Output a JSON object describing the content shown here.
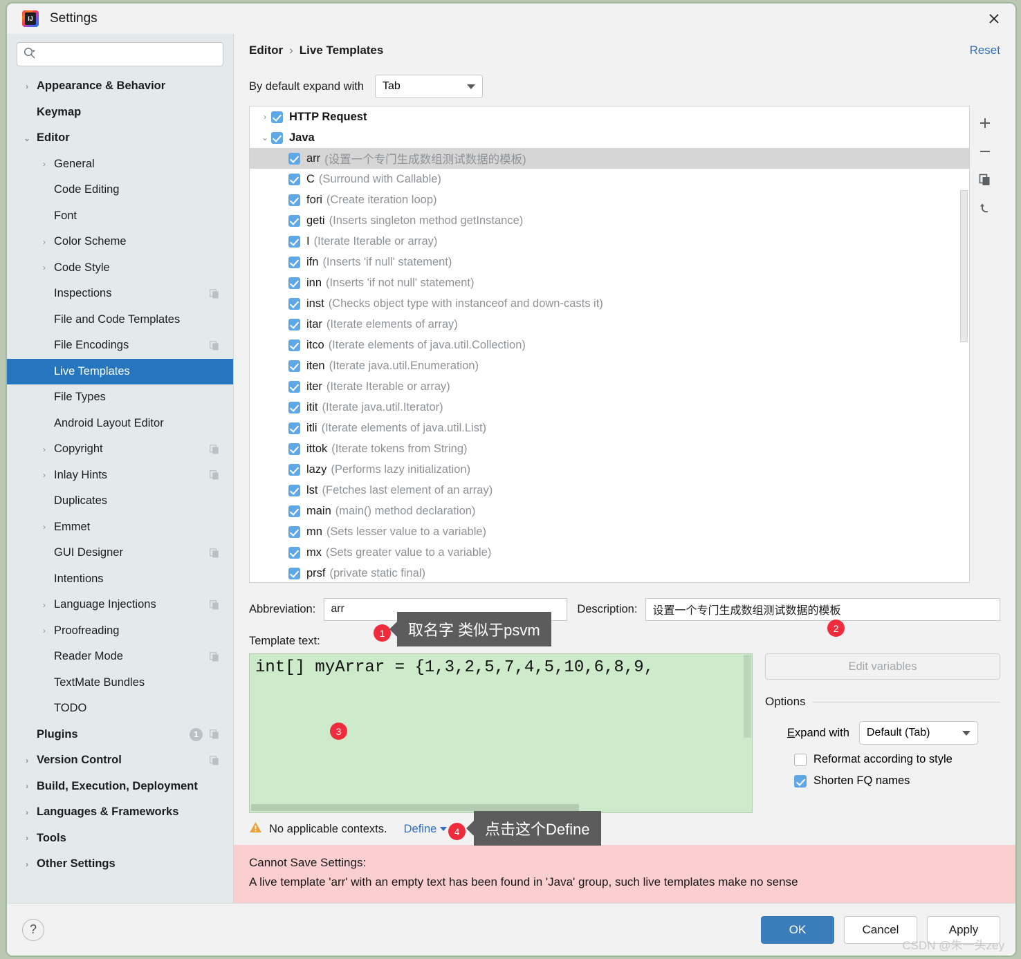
{
  "window": {
    "title": "Settings",
    "close_icon": "close-icon",
    "app_icon": "intellij-idea-icon"
  },
  "sidebar": {
    "search": {
      "placeholder": "",
      "value": "",
      "icon": "search-icon"
    },
    "items": [
      {
        "label": "Appearance & Behavior",
        "level": 0,
        "arrow": "›",
        "bold": true
      },
      {
        "label": "Keymap",
        "level": 0,
        "arrow": "",
        "bold": true
      },
      {
        "label": "Editor",
        "level": 0,
        "arrow": "⌄",
        "bold": true,
        "expanded": true
      },
      {
        "label": "General",
        "level": 1,
        "arrow": "›"
      },
      {
        "label": "Code Editing",
        "level": 1,
        "arrow": ""
      },
      {
        "label": "Font",
        "level": 1,
        "arrow": ""
      },
      {
        "label": "Color Scheme",
        "level": 1,
        "arrow": "›"
      },
      {
        "label": "Code Style",
        "level": 1,
        "arrow": "›"
      },
      {
        "label": "Inspections",
        "level": 1,
        "arrow": "",
        "copy": true
      },
      {
        "label": "File and Code Templates",
        "level": 1,
        "arrow": ""
      },
      {
        "label": "File Encodings",
        "level": 1,
        "arrow": "",
        "copy": true
      },
      {
        "label": "Live Templates",
        "level": 1,
        "arrow": "",
        "selected": true
      },
      {
        "label": "File Types",
        "level": 1,
        "arrow": ""
      },
      {
        "label": "Android Layout Editor",
        "level": 1,
        "arrow": ""
      },
      {
        "label": "Copyright",
        "level": 1,
        "arrow": "›",
        "copy": true
      },
      {
        "label": "Inlay Hints",
        "level": 1,
        "arrow": "›",
        "copy": true
      },
      {
        "label": "Duplicates",
        "level": 1,
        "arrow": ""
      },
      {
        "label": "Emmet",
        "level": 1,
        "arrow": "›"
      },
      {
        "label": "GUI Designer",
        "level": 1,
        "arrow": "",
        "copy": true
      },
      {
        "label": "Intentions",
        "level": 1,
        "arrow": ""
      },
      {
        "label": "Language Injections",
        "level": 1,
        "arrow": "›",
        "copy": true
      },
      {
        "label": "Proofreading",
        "level": 1,
        "arrow": "›"
      },
      {
        "label": "Reader Mode",
        "level": 1,
        "arrow": "",
        "copy": true
      },
      {
        "label": "TextMate Bundles",
        "level": 1,
        "arrow": ""
      },
      {
        "label": "TODO",
        "level": 1,
        "arrow": ""
      },
      {
        "label": "Plugins",
        "level": 0,
        "arrow": "",
        "bold": true,
        "badge": "1",
        "copy": true
      },
      {
        "label": "Version Control",
        "level": 0,
        "arrow": "›",
        "bold": true,
        "copy": true
      },
      {
        "label": "Build, Execution, Deployment",
        "level": 0,
        "arrow": "›",
        "bold": true
      },
      {
        "label": "Languages & Frameworks",
        "level": 0,
        "arrow": "›",
        "bold": true
      },
      {
        "label": "Tools",
        "level": 0,
        "arrow": "›",
        "bold": true
      },
      {
        "label": "Other Settings",
        "level": 0,
        "arrow": "›",
        "bold": true
      }
    ]
  },
  "main": {
    "breadcrumb": {
      "parent": "Editor",
      "separator": "›",
      "current": "Live Templates"
    },
    "reset_label": "Reset",
    "expand_row": {
      "label": "By default expand with",
      "value": "Tab"
    },
    "toolbar": {
      "add": "add-icon",
      "remove": "remove-icon",
      "duplicate": "duplicate-icon",
      "revert": "revert-icon"
    },
    "templates": [
      {
        "name": "HTTP Request",
        "desc": "",
        "group": true,
        "arrow": "›",
        "checked": true
      },
      {
        "name": "Java",
        "desc": "",
        "group": true,
        "arrow": "⌄",
        "checked": true,
        "expanded": true
      },
      {
        "name": "arr",
        "desc": "(设置一个专门生成数组测试数据的模板)",
        "checked": true,
        "selected": true
      },
      {
        "name": "C",
        "desc": "(Surround with Callable)",
        "checked": true
      },
      {
        "name": "fori",
        "desc": "(Create iteration loop)",
        "checked": true
      },
      {
        "name": "geti",
        "desc": "(Inserts singleton method getInstance)",
        "checked": true
      },
      {
        "name": "I",
        "desc": "(Iterate Iterable or array)",
        "checked": true
      },
      {
        "name": "ifn",
        "desc": "(Inserts 'if null' statement)",
        "checked": true
      },
      {
        "name": "inn",
        "desc": "(Inserts 'if not null' statement)",
        "checked": true
      },
      {
        "name": "inst",
        "desc": "(Checks object type with instanceof and down-casts it)",
        "checked": true
      },
      {
        "name": "itar",
        "desc": "(Iterate elements of array)",
        "checked": true
      },
      {
        "name": "itco",
        "desc": "(Iterate elements of java.util.Collection)",
        "checked": true
      },
      {
        "name": "iten",
        "desc": "(Iterate java.util.Enumeration)",
        "checked": true
      },
      {
        "name": "iter",
        "desc": "(Iterate Iterable or array)",
        "checked": true
      },
      {
        "name": "itit",
        "desc": "(Iterate java.util.Iterator)",
        "checked": true
      },
      {
        "name": "itli",
        "desc": "(Iterate elements of java.util.List)",
        "checked": true
      },
      {
        "name": "ittok",
        "desc": "(Iterate tokens from String)",
        "checked": true
      },
      {
        "name": "lazy",
        "desc": "(Performs lazy initialization)",
        "checked": true
      },
      {
        "name": "lst",
        "desc": "(Fetches last element of an array)",
        "checked": true
      },
      {
        "name": "main",
        "desc": "(main() method declaration)",
        "checked": true
      },
      {
        "name": "mn",
        "desc": "(Sets lesser value to a variable)",
        "checked": true
      },
      {
        "name": "mx",
        "desc": "(Sets greater value to a variable)",
        "checked": true
      },
      {
        "name": "prsf",
        "desc": "(private static final)",
        "checked": true
      }
    ],
    "abbreviation": {
      "label": "Abbreviation:",
      "value": "arr"
    },
    "description": {
      "label": "Description:",
      "value": "设置一个专门生成数组测试数据的模板"
    },
    "template_text": {
      "label": "Template text:",
      "value": "int[] myArrar = {1,3,2,5,7,4,5,10,6,8,9,"
    },
    "edit_variables_label": "Edit variables",
    "options": {
      "title": "Options",
      "expand_with_label": "Expand with",
      "expand_with_value": "Default (Tab)",
      "reformat_label": "Reformat according to style",
      "reformat_checked": false,
      "shorten_label": "Shorten FQ names",
      "shorten_checked": true
    },
    "context": {
      "warning_icon": "warning-icon",
      "text": "No applicable contexts.",
      "define_label": "Define"
    },
    "error": {
      "line1": "Cannot Save Settings:",
      "line2": "A live template 'arr' with an empty text has been found in 'Java' group, such live templates make no sense"
    }
  },
  "footer": {
    "help_label": "?",
    "ok_label": "OK",
    "cancel_label": "Cancel",
    "apply_label": "Apply",
    "watermark": "CSDN @朱一头zey"
  },
  "annotations": [
    {
      "number": "1",
      "tip": "取名字 类似于psvm"
    },
    {
      "number": "2",
      "tip": ""
    },
    {
      "number": "3",
      "tip": ""
    },
    {
      "number": "4",
      "tip": "点击这个Define"
    }
  ],
  "colors": {
    "accent": "#2675bf",
    "link": "#2d6fc0",
    "checkbox": "#5fa8e8",
    "editor_bg": "#cdeacb",
    "error_bg": "#fbcfcf",
    "badge": "#f02c3c"
  }
}
